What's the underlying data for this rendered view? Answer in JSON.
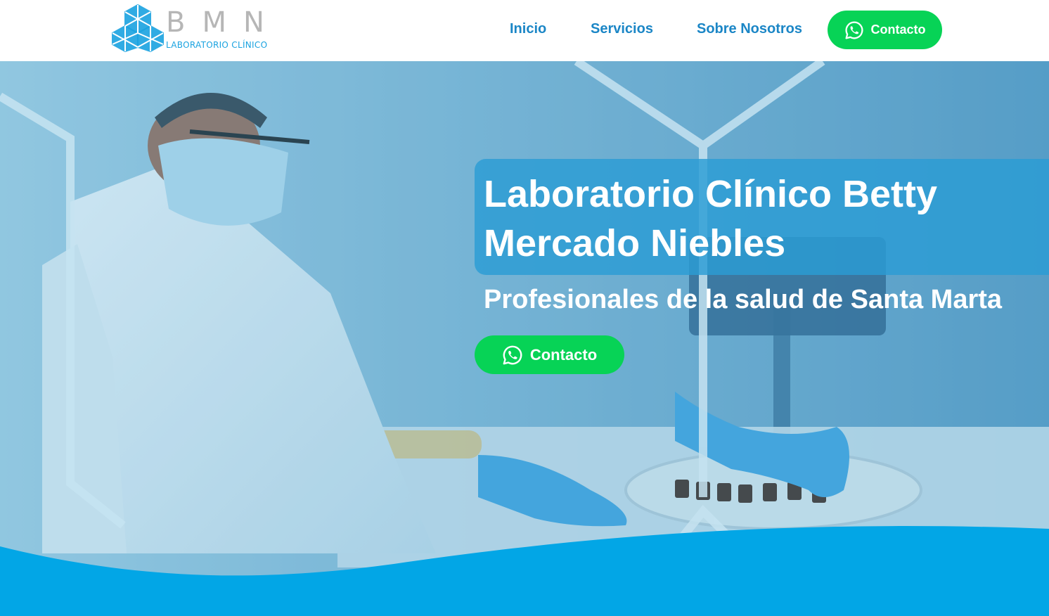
{
  "logo": {
    "letters": "BMN",
    "subtitle": "LABORATORIO CLÍNICO"
  },
  "nav": {
    "items": [
      "Inicio",
      "Servicios",
      "Sobre Nosotros"
    ],
    "contact_label": "Contacto"
  },
  "hero": {
    "title_line1": "Laboratorio Clínico Betty",
    "title_line2": "Mercado Niebles",
    "subtitle": "Profesionales de la salud de Santa Marta",
    "contact_label": "Contacto"
  },
  "colors": {
    "brand_blue": "#1b86c6",
    "accent_cyan": "#02a6e6",
    "whatsapp_green": "#07d356"
  },
  "icons": [
    "logo-hexagon-icon",
    "whatsapp-icon"
  ]
}
